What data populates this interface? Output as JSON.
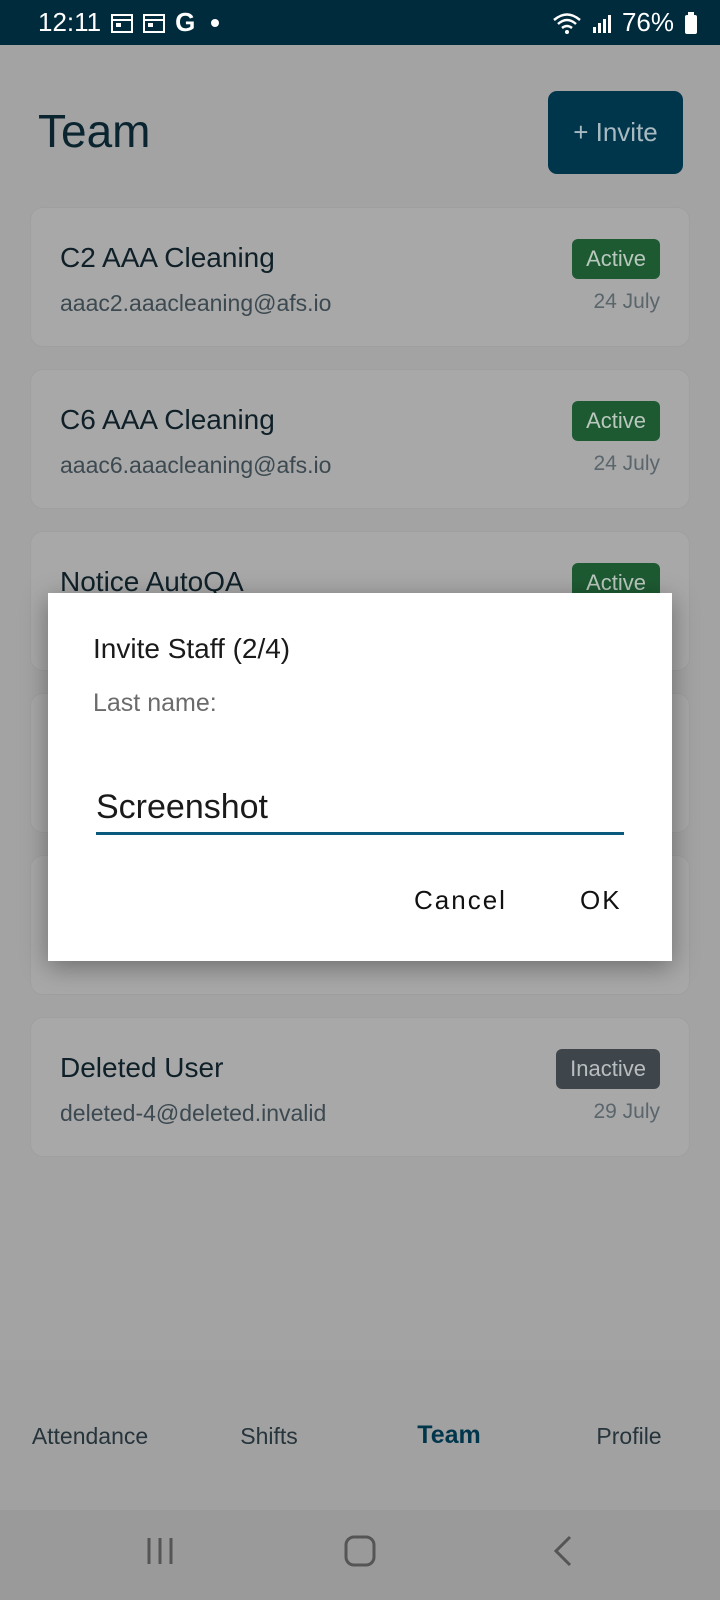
{
  "status_bar": {
    "time": "12:11",
    "google_letter": "G",
    "battery": "76%"
  },
  "header": {
    "title": "Team",
    "invite_label": "+ Invite"
  },
  "members": [
    {
      "name": "C2 AAA Cleaning",
      "email": "aaac2.aaacleaning@afs.io",
      "status": "Active",
      "date": "24 July"
    },
    {
      "name": "C6 AAA Cleaning",
      "email": "aaac6.aaacleaning@afs.io",
      "status": "Active",
      "date": "24 July"
    },
    {
      "name": "Notice AutoQA",
      "status": "Active"
    },
    {
      "name": "Deleted User",
      "email": "deleted-4@deleted.invalid",
      "status": "Inactive",
      "date": "29 July"
    }
  ],
  "dialog": {
    "title": "Invite Staff (2/4)",
    "label": "Last name:",
    "value": "Screenshot",
    "cancel_label": "Cancel",
    "ok_label": "OK"
  },
  "bottom_nav": {
    "items": [
      {
        "label": "Attendance"
      },
      {
        "label": "Shifts"
      },
      {
        "label": "Team"
      },
      {
        "label": "Profile"
      }
    ],
    "selected": "Team"
  },
  "colors": {
    "primary": "#00364c",
    "status_bar": "#002b3d",
    "active_badge": "#1d5a32",
    "inactive_badge": "#3f464b",
    "input_underline": "#0a5a7d"
  },
  "icons": {
    "status_left": [
      "calendar-icon",
      "calendar-icon",
      "google-icon",
      "dot-icon"
    ],
    "status_right": [
      "wifi-icon",
      "signal-icon",
      "battery-icon"
    ],
    "system_nav": [
      "recents-icon",
      "home-icon",
      "back-icon"
    ]
  }
}
